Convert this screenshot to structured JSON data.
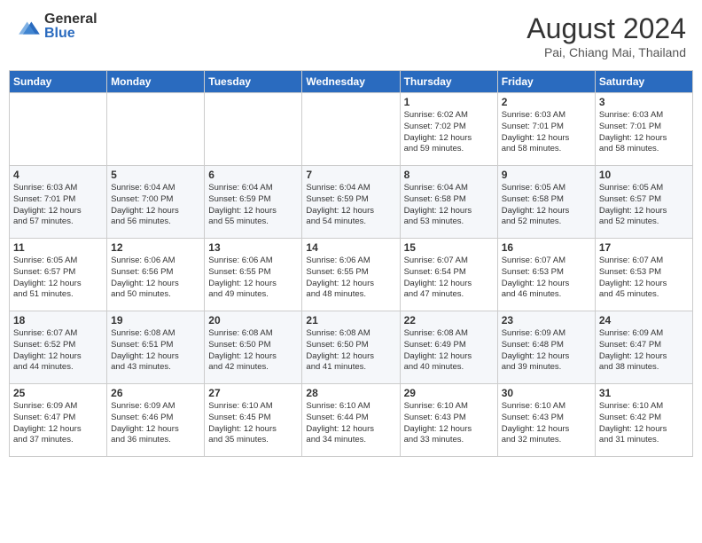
{
  "header": {
    "logo_general": "General",
    "logo_blue": "Blue",
    "month_year": "August 2024",
    "location": "Pai, Chiang Mai, Thailand"
  },
  "days_of_week": [
    "Sunday",
    "Monday",
    "Tuesday",
    "Wednesday",
    "Thursday",
    "Friday",
    "Saturday"
  ],
  "weeks": [
    [
      {
        "day": "",
        "content": ""
      },
      {
        "day": "",
        "content": ""
      },
      {
        "day": "",
        "content": ""
      },
      {
        "day": "",
        "content": ""
      },
      {
        "day": "1",
        "content": "Sunrise: 6:02 AM\nSunset: 7:02 PM\nDaylight: 12 hours\nand 59 minutes."
      },
      {
        "day": "2",
        "content": "Sunrise: 6:03 AM\nSunset: 7:01 PM\nDaylight: 12 hours\nand 58 minutes."
      },
      {
        "day": "3",
        "content": "Sunrise: 6:03 AM\nSunset: 7:01 PM\nDaylight: 12 hours\nand 58 minutes."
      }
    ],
    [
      {
        "day": "4",
        "content": "Sunrise: 6:03 AM\nSunset: 7:01 PM\nDaylight: 12 hours\nand 57 minutes."
      },
      {
        "day": "5",
        "content": "Sunrise: 6:04 AM\nSunset: 7:00 PM\nDaylight: 12 hours\nand 56 minutes."
      },
      {
        "day": "6",
        "content": "Sunrise: 6:04 AM\nSunset: 6:59 PM\nDaylight: 12 hours\nand 55 minutes."
      },
      {
        "day": "7",
        "content": "Sunrise: 6:04 AM\nSunset: 6:59 PM\nDaylight: 12 hours\nand 54 minutes."
      },
      {
        "day": "8",
        "content": "Sunrise: 6:04 AM\nSunset: 6:58 PM\nDaylight: 12 hours\nand 53 minutes."
      },
      {
        "day": "9",
        "content": "Sunrise: 6:05 AM\nSunset: 6:58 PM\nDaylight: 12 hours\nand 52 minutes."
      },
      {
        "day": "10",
        "content": "Sunrise: 6:05 AM\nSunset: 6:57 PM\nDaylight: 12 hours\nand 52 minutes."
      }
    ],
    [
      {
        "day": "11",
        "content": "Sunrise: 6:05 AM\nSunset: 6:57 PM\nDaylight: 12 hours\nand 51 minutes."
      },
      {
        "day": "12",
        "content": "Sunrise: 6:06 AM\nSunset: 6:56 PM\nDaylight: 12 hours\nand 50 minutes."
      },
      {
        "day": "13",
        "content": "Sunrise: 6:06 AM\nSunset: 6:55 PM\nDaylight: 12 hours\nand 49 minutes."
      },
      {
        "day": "14",
        "content": "Sunrise: 6:06 AM\nSunset: 6:55 PM\nDaylight: 12 hours\nand 48 minutes."
      },
      {
        "day": "15",
        "content": "Sunrise: 6:07 AM\nSunset: 6:54 PM\nDaylight: 12 hours\nand 47 minutes."
      },
      {
        "day": "16",
        "content": "Sunrise: 6:07 AM\nSunset: 6:53 PM\nDaylight: 12 hours\nand 46 minutes."
      },
      {
        "day": "17",
        "content": "Sunrise: 6:07 AM\nSunset: 6:53 PM\nDaylight: 12 hours\nand 45 minutes."
      }
    ],
    [
      {
        "day": "18",
        "content": "Sunrise: 6:07 AM\nSunset: 6:52 PM\nDaylight: 12 hours\nand 44 minutes."
      },
      {
        "day": "19",
        "content": "Sunrise: 6:08 AM\nSunset: 6:51 PM\nDaylight: 12 hours\nand 43 minutes."
      },
      {
        "day": "20",
        "content": "Sunrise: 6:08 AM\nSunset: 6:50 PM\nDaylight: 12 hours\nand 42 minutes."
      },
      {
        "day": "21",
        "content": "Sunrise: 6:08 AM\nSunset: 6:50 PM\nDaylight: 12 hours\nand 41 minutes."
      },
      {
        "day": "22",
        "content": "Sunrise: 6:08 AM\nSunset: 6:49 PM\nDaylight: 12 hours\nand 40 minutes."
      },
      {
        "day": "23",
        "content": "Sunrise: 6:09 AM\nSunset: 6:48 PM\nDaylight: 12 hours\nand 39 minutes."
      },
      {
        "day": "24",
        "content": "Sunrise: 6:09 AM\nSunset: 6:47 PM\nDaylight: 12 hours\nand 38 minutes."
      }
    ],
    [
      {
        "day": "25",
        "content": "Sunrise: 6:09 AM\nSunset: 6:47 PM\nDaylight: 12 hours\nand 37 minutes."
      },
      {
        "day": "26",
        "content": "Sunrise: 6:09 AM\nSunset: 6:46 PM\nDaylight: 12 hours\nand 36 minutes."
      },
      {
        "day": "27",
        "content": "Sunrise: 6:10 AM\nSunset: 6:45 PM\nDaylight: 12 hours\nand 35 minutes."
      },
      {
        "day": "28",
        "content": "Sunrise: 6:10 AM\nSunset: 6:44 PM\nDaylight: 12 hours\nand 34 minutes."
      },
      {
        "day": "29",
        "content": "Sunrise: 6:10 AM\nSunset: 6:43 PM\nDaylight: 12 hours\nand 33 minutes."
      },
      {
        "day": "30",
        "content": "Sunrise: 6:10 AM\nSunset: 6:43 PM\nDaylight: 12 hours\nand 32 minutes."
      },
      {
        "day": "31",
        "content": "Sunrise: 6:10 AM\nSunset: 6:42 PM\nDaylight: 12 hours\nand 31 minutes."
      }
    ]
  ]
}
